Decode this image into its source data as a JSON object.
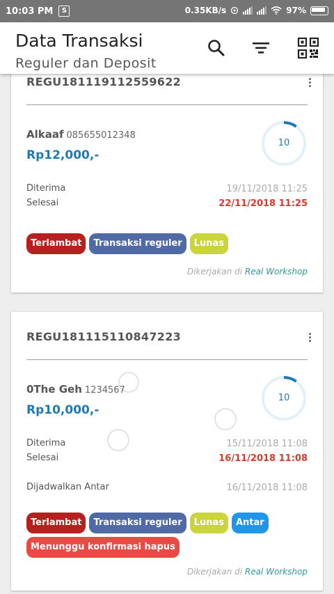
{
  "status_bar": {
    "time": "10:03 PM",
    "app_icon": "S",
    "net_speed": "0.35KB/s",
    "battery": "97%"
  },
  "header": {
    "title": "Data Transaksi",
    "subtitle": "Reguler dan Deposit",
    "icons": [
      "search-icon",
      "filter-icon",
      "qr-code-icon"
    ]
  },
  "transactions": [
    {
      "id": "REGU181119112559622",
      "name": "Alkaaf",
      "phone": "085655012348",
      "price": "Rp12,000,-",
      "progress_label": "10",
      "progress": 0.1,
      "diterima_label": "Diterima",
      "diterima_value": "19/11/2018 11:25",
      "selesai_label": "Selesai",
      "selesai_value": "22/11/2018 11:25",
      "tags": [
        "Terlambat",
        "Transaksi reguler",
        "Lunas"
      ],
      "footer_prefix": "Dikerjakan di",
      "footer_workshop": "Real Workshop"
    },
    {
      "id": "REGU181115110847223",
      "name": "0The Geh",
      "phone": "1234567",
      "price": "Rp10,000,-",
      "progress_label": "10",
      "progress": 0.1,
      "diterima_label": "Diterima",
      "diterima_value": "15/11/2018 11:08",
      "selesai_label": "Selesai",
      "selesai_value": "16/11/2018 11:08",
      "antar_label": "Dijadwalkan Antar",
      "antar_value": "16/11/2018 11:08",
      "tags": [
        "Terlambat",
        "Transaksi reguler",
        "Lunas",
        "Antar",
        "Menunggu konfirmasi hapus"
      ],
      "footer_prefix": "Dikerjakan di",
      "footer_workshop": "Real Workshop"
    }
  ],
  "colors": {
    "accent_blue": "#1e7ab1",
    "late_red": "#b7201e",
    "reguler_blue": "#4f6aa5",
    "lunas_green": "#c9d53a",
    "antar_blue": "#2196e9",
    "hapus_red": "#e84a45",
    "workshop_teal": "#2b9c96"
  }
}
